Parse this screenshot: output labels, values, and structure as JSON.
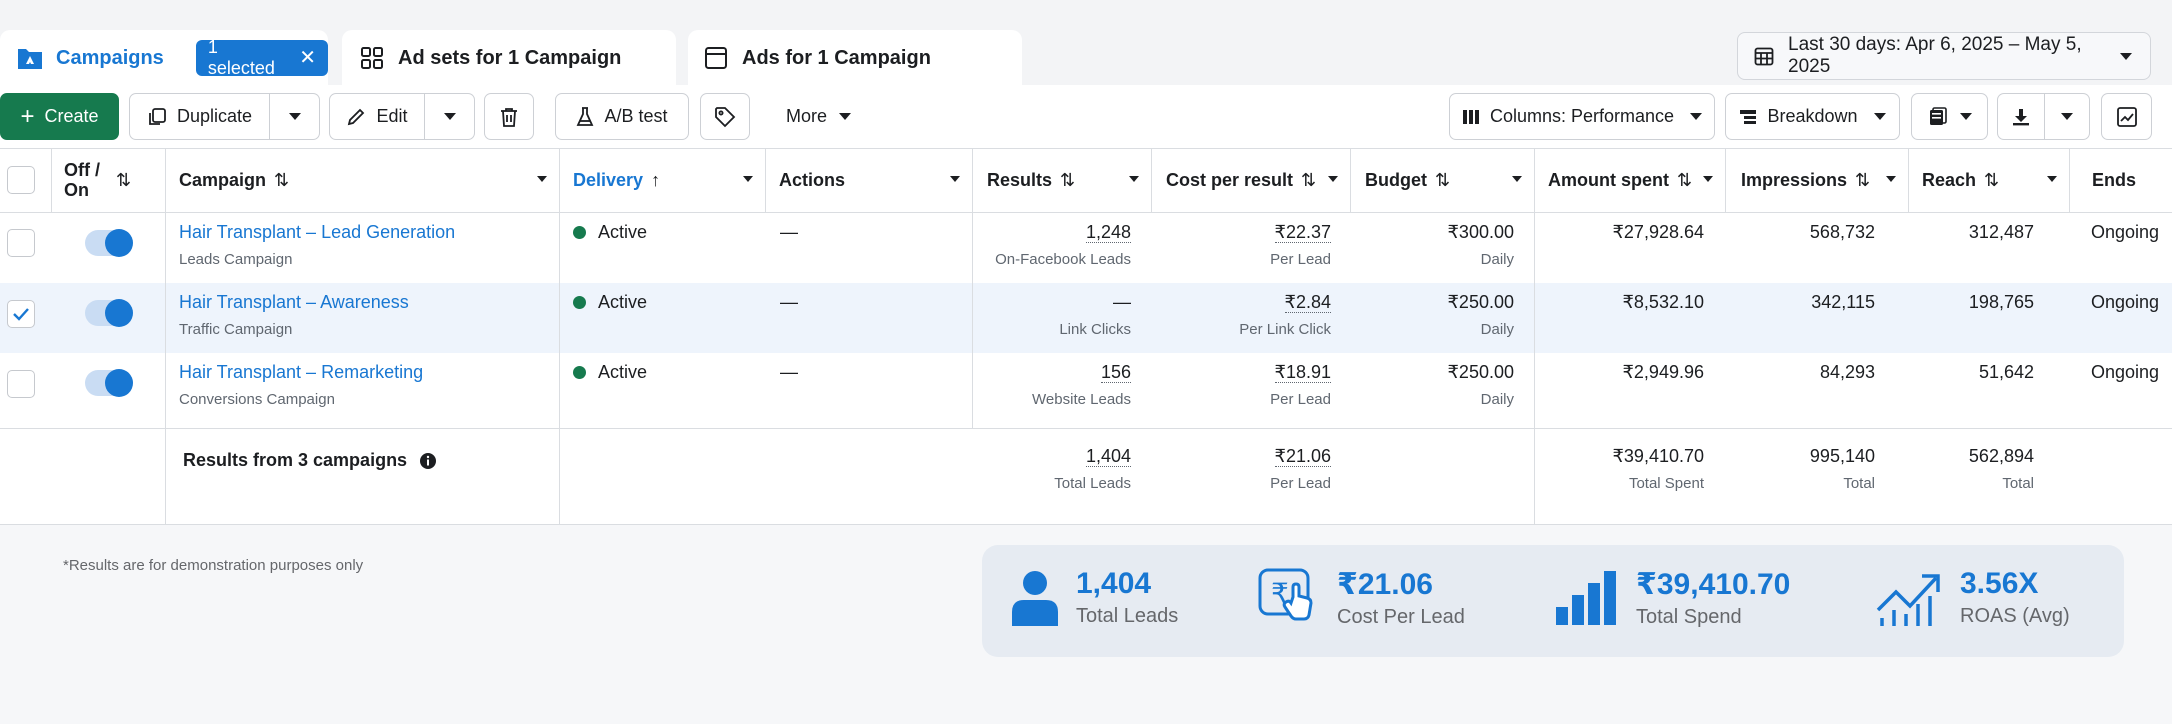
{
  "tabs": {
    "campaigns": {
      "label": "Campaigns",
      "selected_label": "1 selected"
    },
    "adsets": {
      "label": "Ad sets for 1 Campaign"
    },
    "ads": {
      "label": "Ads for 1 Campaign"
    }
  },
  "date_range": "Last 30 days: Apr 6, 2025 – May 5, 2025",
  "toolbar": {
    "create": "Create",
    "duplicate": "Duplicate",
    "edit": "Edit",
    "ab_test": "A/B test",
    "more": "More",
    "columns": "Columns: Performance",
    "breakdown": "Breakdown"
  },
  "headers": {
    "off_on": "Off / On",
    "campaign": "Campaign",
    "delivery": "Delivery",
    "actions": "Actions",
    "results": "Results",
    "cost_per_result": "Cost per result",
    "budget": "Budget",
    "amount_spent": "Amount spent",
    "impressions": "Impressions",
    "reach": "Reach",
    "ends": "Ends"
  },
  "rows": [
    {
      "name": "Hair Transplant – Lead Generation",
      "type": "Leads Campaign",
      "delivery": "Active",
      "actions": "—",
      "results": "1,248",
      "results_sub": "On-Facebook Leads",
      "cpr": "₹22.37",
      "cpr_sub": "Per Lead",
      "budget": "₹300.00",
      "budget_sub": "Daily",
      "spent": "₹27,928.64",
      "impressions": "568,732",
      "reach": "312,487",
      "ends": "Ongoing",
      "selected": false
    },
    {
      "name": "Hair Transplant – Awareness",
      "type": "Traffic Campaign",
      "delivery": "Active",
      "actions": "—",
      "results": "—",
      "results_sub": "Link Clicks",
      "cpr": "₹2.84",
      "cpr_sub": "Per Link Click",
      "budget": "₹250.00",
      "budget_sub": "Daily",
      "spent": "₹8,532.10",
      "impressions": "342,115",
      "reach": "198,765",
      "ends": "Ongoing",
      "selected": true
    },
    {
      "name": "Hair Transplant – Remarketing",
      "type": "Conversions Campaign",
      "delivery": "Active",
      "actions": "—",
      "results": "156",
      "results_sub": "Website Leads",
      "cpr": "₹18.91",
      "cpr_sub": "Per Lead",
      "budget": "₹250.00",
      "budget_sub": "Daily",
      "spent": "₹2,949.96",
      "impressions": "84,293",
      "reach": "51,642",
      "ends": "Ongoing",
      "selected": false
    }
  ],
  "totals": {
    "label": "Results from 3 campaigns",
    "results": "1,404",
    "results_sub": "Total Leads",
    "cpr": "₹21.06",
    "cpr_sub": "Per Lead",
    "spent": "₹39,410.70",
    "spent_sub": "Total Spent",
    "impressions": "995,140",
    "impressions_sub": "Total",
    "reach": "562,894",
    "reach_sub": "Total"
  },
  "footnote": "*Results are for demonstration purposes only",
  "summary": {
    "leads": {
      "value": "1,404",
      "caption": "Total Leads",
      "icon": "person-icon"
    },
    "cpl": {
      "value": "₹21.06",
      "caption": "Cost Per Lead",
      "icon": "rupee-click-icon"
    },
    "spend": {
      "value": "₹39,410.70",
      "caption": "Total Spend",
      "icon": "bar-chart-icon"
    },
    "roas": {
      "value": "3.56X",
      "caption": "ROAS (Avg)",
      "icon": "trend-up-icon"
    }
  },
  "colors": {
    "accent": "#1877d2",
    "create_green": "#167a4e",
    "active_dot": "#167a4e",
    "selected_row": "#eef4fc"
  }
}
